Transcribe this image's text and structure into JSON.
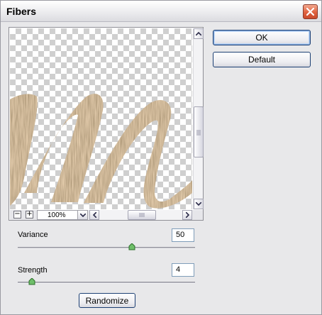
{
  "window": {
    "title": "Fibers"
  },
  "buttons": {
    "ok": "OK",
    "default": "Default",
    "randomize": "Randomize"
  },
  "preview": {
    "zoom": "100%",
    "zoom_out_symbol": "−",
    "zoom_in_symbol": "+"
  },
  "controls": {
    "variance": {
      "label": "Variance",
      "value": "50",
      "max": 64
    },
    "strength": {
      "label": "Strength",
      "value": "4",
      "max": 64
    }
  },
  "colors": {
    "fiber_dark": "#6e5233",
    "fiber_light": "#c6a77d",
    "close_button": "#e0613f",
    "button_border": "#1c3f73"
  }
}
